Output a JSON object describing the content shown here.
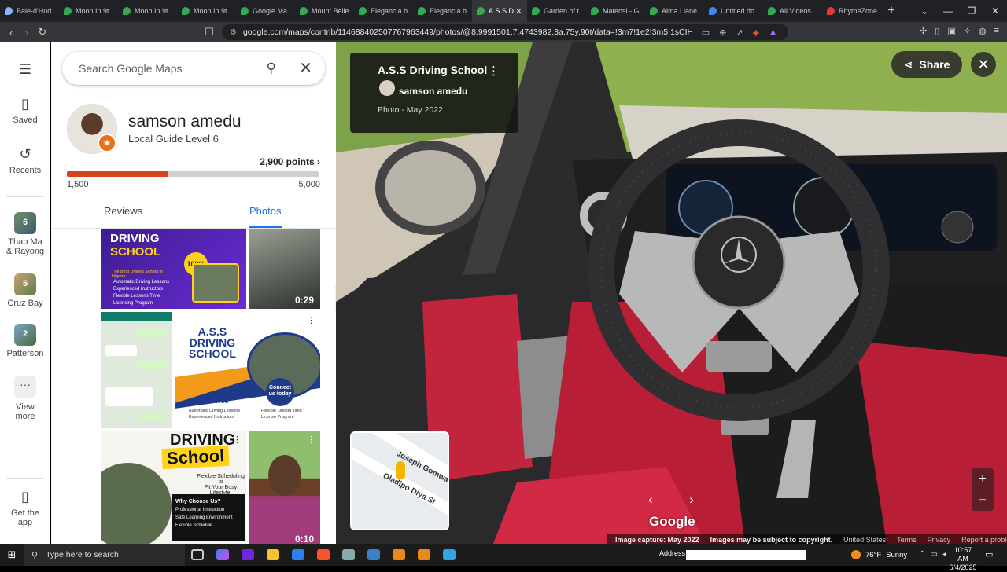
{
  "browser": {
    "tabs": [
      {
        "label": "Baie-d'Hud",
        "color": "#8ab4f8"
      },
      {
        "label": "Moon In 9t",
        "color": "#34a853"
      },
      {
        "label": "Moon In 9t",
        "color": "#34a853"
      },
      {
        "label": "Moon In 9t",
        "color": "#34a853"
      },
      {
        "label": "Google Ma",
        "color": "#34a853"
      },
      {
        "label": "Mount Belle",
        "color": "#34a853"
      },
      {
        "label": "Elegancia b",
        "color": "#34a853"
      },
      {
        "label": "Elegancia b",
        "color": "#34a853"
      },
      {
        "label": "A.S.S D",
        "color": "#34a853",
        "active": true
      },
      {
        "label": "Garden of t",
        "color": "#34a853"
      },
      {
        "label": "Mateosi - G",
        "color": "#34a853"
      },
      {
        "label": "Alma Llane",
        "color": "#34a853"
      },
      {
        "label": "Untitled do",
        "color": "#4285f4"
      },
      {
        "label": "All Videos",
        "color": "#34a853"
      },
      {
        "label": "RhymeZone",
        "color": "#e53935"
      }
    ],
    "url": "google.com/maps/contrib/114688402507767963449/photos/@8.9991501,7.4743982,3a,75y,90t/data=!3m7!1e2!3m5!1sCIHM0ogKEICAgI..."
  },
  "rail": {
    "saved": "Saved",
    "recents": "Recents",
    "recent_places": [
      {
        "count": "6",
        "label_line1": "Thap Ma",
        "label_line2": "& Rayong"
      },
      {
        "count": "5",
        "label_line1": "Cruz Bay",
        "label_line2": ""
      },
      {
        "count": "2",
        "label_line1": "Patterson",
        "label_line2": ""
      }
    ],
    "view_more_1": "View",
    "view_more_2": "more",
    "get_app_1": "Get the",
    "get_app_2": "app"
  },
  "search": {
    "placeholder": "Search Google Maps"
  },
  "profile": {
    "name": "samson amedu",
    "level": "Local Guide Level 6",
    "points": "2,900 points",
    "progress_fraction": 0.4,
    "range_min": "1,500",
    "range_max": "5,000"
  },
  "tabs": {
    "reviews": "Reviews",
    "photos": "Photos"
  },
  "photos": {
    "p1": {
      "title1": "DRIVING",
      "title2": "SCHOOL",
      "badge": "100%",
      "sub": "The Best Driving School in Nigeria",
      "items": [
        "Automatic Driving Lessons",
        "Experienced Instructors",
        "Flexible Lessons Time",
        "Licensing Program"
      ]
    },
    "p2": {
      "duration": "0:29"
    },
    "p4": {
      "t1": "A.S.S",
      "t2": "DRIVING",
      "t3": "SCHOOL",
      "connect1": "Connect",
      "connect2": "us today",
      "service": "Our Service",
      "items": [
        "Automatic Driving Lessons",
        "Experienced Instructors",
        "Flexible Lesson Time",
        "License Program"
      ]
    },
    "p5": {
      "t1": "DRIVING",
      "t2": "School",
      "sub1": "Flexible Scheduling to",
      "sub2": "Fit Your Busy Lifestyle!",
      "why": "Why Choose Us?",
      "why_items": [
        "Professional Instruction",
        "Safe Learning Environment",
        "Flexible Schedule"
      ]
    },
    "p6": {
      "duration": "0:10"
    }
  },
  "viewer": {
    "place": "A.S.S Driving School",
    "author": "samson amedu",
    "date": "Photo - May 2022",
    "share": "Share",
    "google": "Google",
    "map_road1": "Joseph Gomwalk S",
    "map_road2": "Oladipo Diya St",
    "footer": {
      "capture": "Image capture: May 2022",
      "copyright": "Images may be subject to copyright.",
      "country": "United States",
      "terms": "Terms",
      "privacy": "Privacy",
      "report": "Report a problem"
    }
  },
  "taskbar": {
    "search_placeholder": "Type here to search",
    "address_label": "Address",
    "temp": "76°F",
    "weather": "Sunny",
    "time": "10:57 AM",
    "date": "6/4/2025"
  }
}
